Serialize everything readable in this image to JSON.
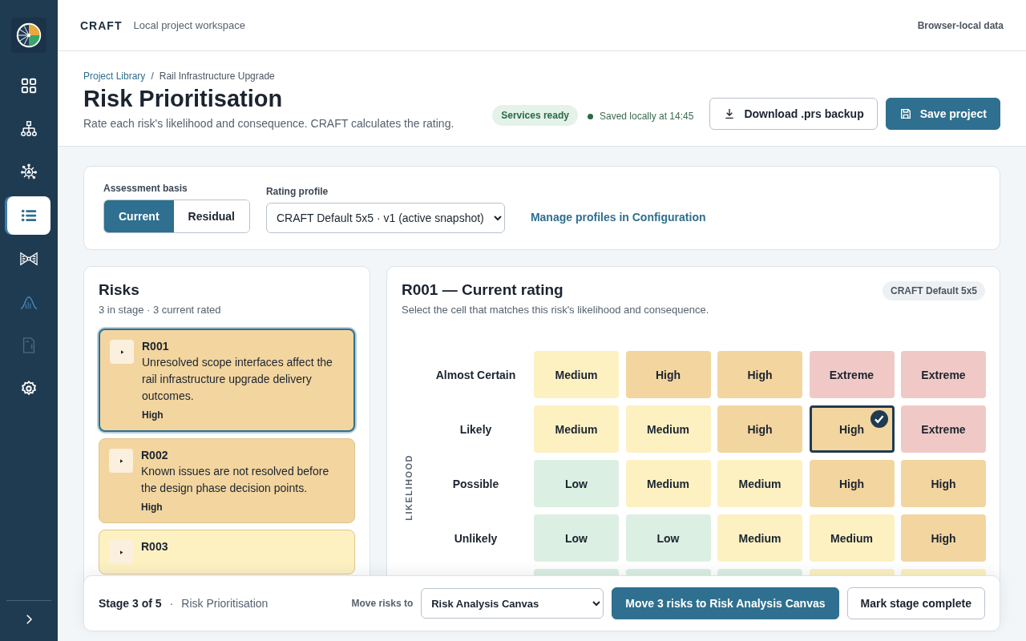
{
  "sidebar": {
    "items": [
      {
        "kind": "grid",
        "selected": false,
        "disabled": false
      },
      {
        "kind": "hierarchy",
        "selected": false,
        "disabled": false
      },
      {
        "kind": "network",
        "selected": false,
        "disabled": false
      },
      {
        "kind": "list",
        "selected": true,
        "disabled": false
      },
      {
        "kind": "bowtie",
        "selected": false,
        "disabled": false
      },
      {
        "kind": "curve",
        "selected": false,
        "disabled": false
      },
      {
        "kind": "document",
        "selected": false,
        "disabled": true
      },
      {
        "kind": "settings",
        "selected": false,
        "disabled": false
      }
    ]
  },
  "topbar": {
    "brand": "CRAFT",
    "subtitle": "Local project workspace",
    "data_note": "Browser-local data"
  },
  "page_header": {
    "breadcrumb": [
      "Project Library",
      "Rail Infrastructure Upgrade"
    ],
    "breadcrumb_separator": "/",
    "title": "Risk Prioritisation",
    "description": "Rate each risk's likelihood and consequence. CRAFT calculates the rating.",
    "status_badge": "Services ready",
    "saved": "Saved locally at 14:45",
    "buttons": [
      {
        "label": "Download .prs backup",
        "kind": "download"
      },
      {
        "label": "Save project",
        "kind": "save"
      }
    ]
  },
  "assessment": {
    "basis_label": "Assessment basis",
    "basis_options": [
      {
        "label": "Current",
        "selected": true
      },
      {
        "label": "Residual",
        "selected": false
      }
    ],
    "profile_label": "Rating profile",
    "profile_value": "CRAFT Default 5x5 · v1 (active snapshot)",
    "manage_link": "Manage profiles in Configuration"
  },
  "risks": {
    "title": "Risks",
    "summary": "3 in stage · 3 current rated",
    "items": [
      {
        "id": "R001",
        "description": "Unresolved scope interfaces affect the rail infrastructure upgrade delivery outcomes.",
        "rating": "High",
        "color": "#f3d59f",
        "selected": true
      },
      {
        "id": "R002",
        "description": "Known issues are not resolved before the design phase decision points.",
        "rating": "High",
        "color": "#f3d59f",
        "selected": false
      },
      {
        "id": "R003",
        "color": "#fdf1c2",
        "selected": false
      }
    ]
  },
  "rating": {
    "title": "R001 — Current rating",
    "subtitle": "Select the cell that matches this risk's likelihood and consequence.",
    "profile_badge": "CRAFT Default 5x5",
    "axis_label": "LIKELIHOOD",
    "rows": [
      {
        "label": "Almost Certain",
        "cells": [
          {
            "label": "Medium",
            "color": "#fdf1c2",
            "selected": false
          },
          {
            "label": "High",
            "color": "#f3d59f",
            "selected": false
          },
          {
            "label": "High",
            "color": "#f3d59f",
            "selected": false
          },
          {
            "label": "Extreme",
            "color": "#f0c9c6",
            "selected": false
          },
          {
            "label": "Extreme",
            "color": "#f0c9c6",
            "selected": false
          }
        ]
      },
      {
        "label": "Likely",
        "cells": [
          {
            "label": "Medium",
            "color": "#fdf1c2",
            "selected": false
          },
          {
            "label": "Medium",
            "color": "#fdf1c2",
            "selected": false
          },
          {
            "label": "High",
            "color": "#f3d59f",
            "selected": false
          },
          {
            "label": "High",
            "color": "#f3d59f",
            "selected": true
          },
          {
            "label": "Extreme",
            "color": "#f0c9c6",
            "selected": false
          }
        ]
      },
      {
        "label": "Possible",
        "cells": [
          {
            "label": "Low",
            "color": "#dcefe3",
            "selected": false
          },
          {
            "label": "Medium",
            "color": "#fdf1c2",
            "selected": false
          },
          {
            "label": "Medium",
            "color": "#fdf1c2",
            "selected": false
          },
          {
            "label": "High",
            "color": "#f3d59f",
            "selected": false
          },
          {
            "label": "High",
            "color": "#f3d59f",
            "selected": false
          }
        ]
      },
      {
        "label": "Unlikely",
        "cells": [
          {
            "label": "Low",
            "color": "#dcefe3",
            "selected": false
          },
          {
            "label": "Low",
            "color": "#dcefe3",
            "selected": false
          },
          {
            "label": "Medium",
            "color": "#fdf1c2",
            "selected": false
          },
          {
            "label": "Medium",
            "color": "#fdf1c2",
            "selected": false
          },
          {
            "label": "High",
            "color": "#f3d59f",
            "selected": false
          }
        ]
      },
      {
        "cells": [
          {
            "color": "#dcefe3",
            "selected": false
          },
          {
            "color": "#dcefe3",
            "selected": false
          },
          {
            "color": "#dcefe3",
            "selected": false
          },
          {
            "color": "#fdf1c2",
            "selected": false
          },
          {
            "color": "#fdf1c2",
            "selected": false
          }
        ]
      }
    ]
  },
  "stage_bar": {
    "stage": "Stage 3 of 5",
    "separator": "·",
    "stage_name": "Risk Prioritisation",
    "move_label": "Move risks to",
    "move_target": "Risk Analysis Canvas",
    "move_button": "Move 3 risks to Risk Analysis Canvas",
    "complete_button": "Mark stage complete"
  }
}
